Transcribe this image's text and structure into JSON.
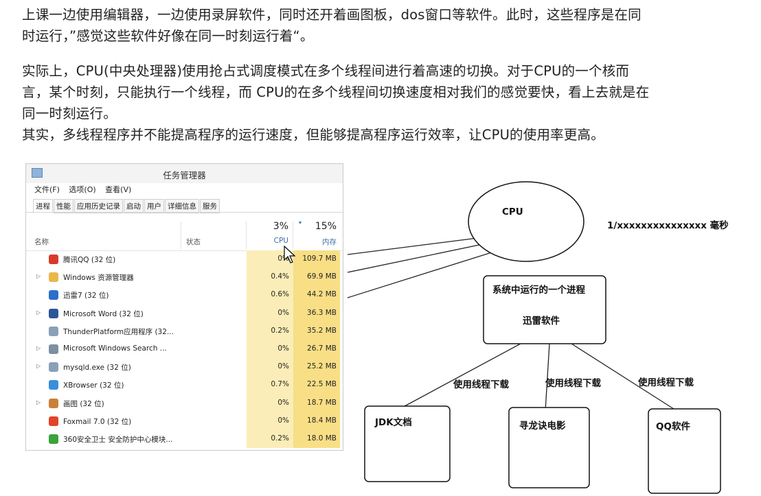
{
  "text": {
    "p1_line1": "上课一边使用编辑器，一边使用录屏软件，同时还开着画图板，dos窗口等软件。此时，这些程序是在同",
    "p1_line2": "时运行，”感觉这些软件好像在同一时刻运行着“。",
    "p2_line1": "实际上，CPU(中央处理器)使用抢占式调度模式在多个线程间进行着高速的切换。对于CPU的一个核而",
    "p2_line2": "言，某个时刻，只能执行一个线程，而 CPU的在多个线程间切换速度相对我们的感觉要快，看上去就是在",
    "p2_line3": "同一时刻运行。",
    "p3_line1": "其实，多线程程序并不能提高程序的运行速度，但能够提高程序运行效率，让CPU的使用率更高。"
  },
  "task_manager": {
    "title": "任务管理器",
    "menu": [
      "文件(F)",
      "选项(O)",
      "查看(V)"
    ],
    "tabs": [
      "进程",
      "性能",
      "应用历史记录",
      "启动",
      "用户",
      "详细信息",
      "服务"
    ],
    "columns": {
      "name": "名称",
      "status": "状态",
      "cpu_pct": "3%",
      "cpu": "CPU",
      "mem_pct": "15%",
      "mem": "内存"
    },
    "rows": [
      {
        "name": "腾讯QQ (32 位)",
        "cpu": "0%",
        "mem": "109.7 MB",
        "icon": "qq-penguin-icon",
        "color": "#d83b2a",
        "expandable": false
      },
      {
        "name": "Windows 资源管理器",
        "cpu": "0.4%",
        "mem": "69.9 MB",
        "icon": "folder-icon",
        "color": "#e8b84a",
        "expandable": true
      },
      {
        "name": "迅雷7 (32 位)",
        "cpu": "0.6%",
        "mem": "44.2 MB",
        "icon": "thunder-icon",
        "color": "#2a6fc9",
        "expandable": false
      },
      {
        "name": "Microsoft Word (32 位)",
        "cpu": "0%",
        "mem": "36.3 MB",
        "icon": "word-icon",
        "color": "#2b5797",
        "expandable": true
      },
      {
        "name": "ThunderPlatform应用程序 (32...",
        "cpu": "0.2%",
        "mem": "35.2 MB",
        "icon": "app-window-icon",
        "color": "#8aa0b8",
        "expandable": false
      },
      {
        "name": "Microsoft Windows Search ...",
        "cpu": "0%",
        "mem": "26.7 MB",
        "icon": "search-user-icon",
        "color": "#7d8fa3",
        "expandable": true
      },
      {
        "name": "mysqld.exe (32 位)",
        "cpu": "0%",
        "mem": "25.2 MB",
        "icon": "app-window-icon",
        "color": "#8aa0b8",
        "expandable": true
      },
      {
        "name": "XBrowser (32 位)",
        "cpu": "0.7%",
        "mem": "22.5 MB",
        "icon": "browser-icon",
        "color": "#3a8fd9",
        "expandable": false
      },
      {
        "name": "画图 (32 位)",
        "cpu": "0%",
        "mem": "18.7 MB",
        "icon": "paint-icon",
        "color": "#c9813a",
        "expandable": true
      },
      {
        "name": "Foxmail 7.0 (32 位)",
        "cpu": "0%",
        "mem": "18.4 MB",
        "icon": "foxmail-icon",
        "color": "#e0442a",
        "expandable": false
      },
      {
        "name": "360安全卫士 安全防护中心模块...",
        "cpu": "0.2%",
        "mem": "18.0 MB",
        "icon": "shield-360-icon",
        "color": "#3aa33a",
        "expandable": false
      }
    ]
  },
  "diagram": {
    "cpu": "CPU",
    "timeslice": "1/xxxxxxxxxxxxxxx 毫秒",
    "process_title": "系统中运行的一个进程",
    "process_name": "迅雷软件",
    "thread_label": "使用线程下载",
    "tasks": [
      "JDK文档",
      "寻龙诀电影",
      "QQ软件"
    ]
  }
}
